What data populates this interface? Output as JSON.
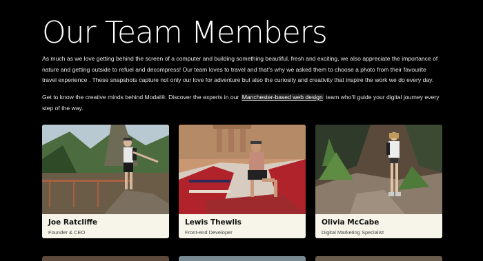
{
  "heading": "Our Team Members",
  "intro": "As much as we love getting behind the screen of a computer and building something beautiful, fresh and exciting, we also appreciate the importance of nature and getting outside to refuel and decompress! Our team loves to travel and that’s why we asked them to choose a photo from their favourite travel experience . These snapshots capture not only our love for adventure but also the curiosity and creativity that inspire the work we do every day.",
  "intro2_before": "Get to know the creative minds behind Modal®. Discover the experts in our ",
  "intro2_link": "Manchester-based web design",
  "intro2_after": " team who’ll guide your digital journey every step of the way.",
  "team": [
    {
      "name": "Joe Ratcliffe",
      "role": "Founder & CEO"
    },
    {
      "name": "Lewis Thewlis",
      "role": "Front-end Developer"
    },
    {
      "name": "Olivia McCabe",
      "role": "Digital Marketing Specialist"
    }
  ],
  "colors": {
    "background": "#000000",
    "card": "#f7f5ea",
    "text": "#ffffff"
  }
}
